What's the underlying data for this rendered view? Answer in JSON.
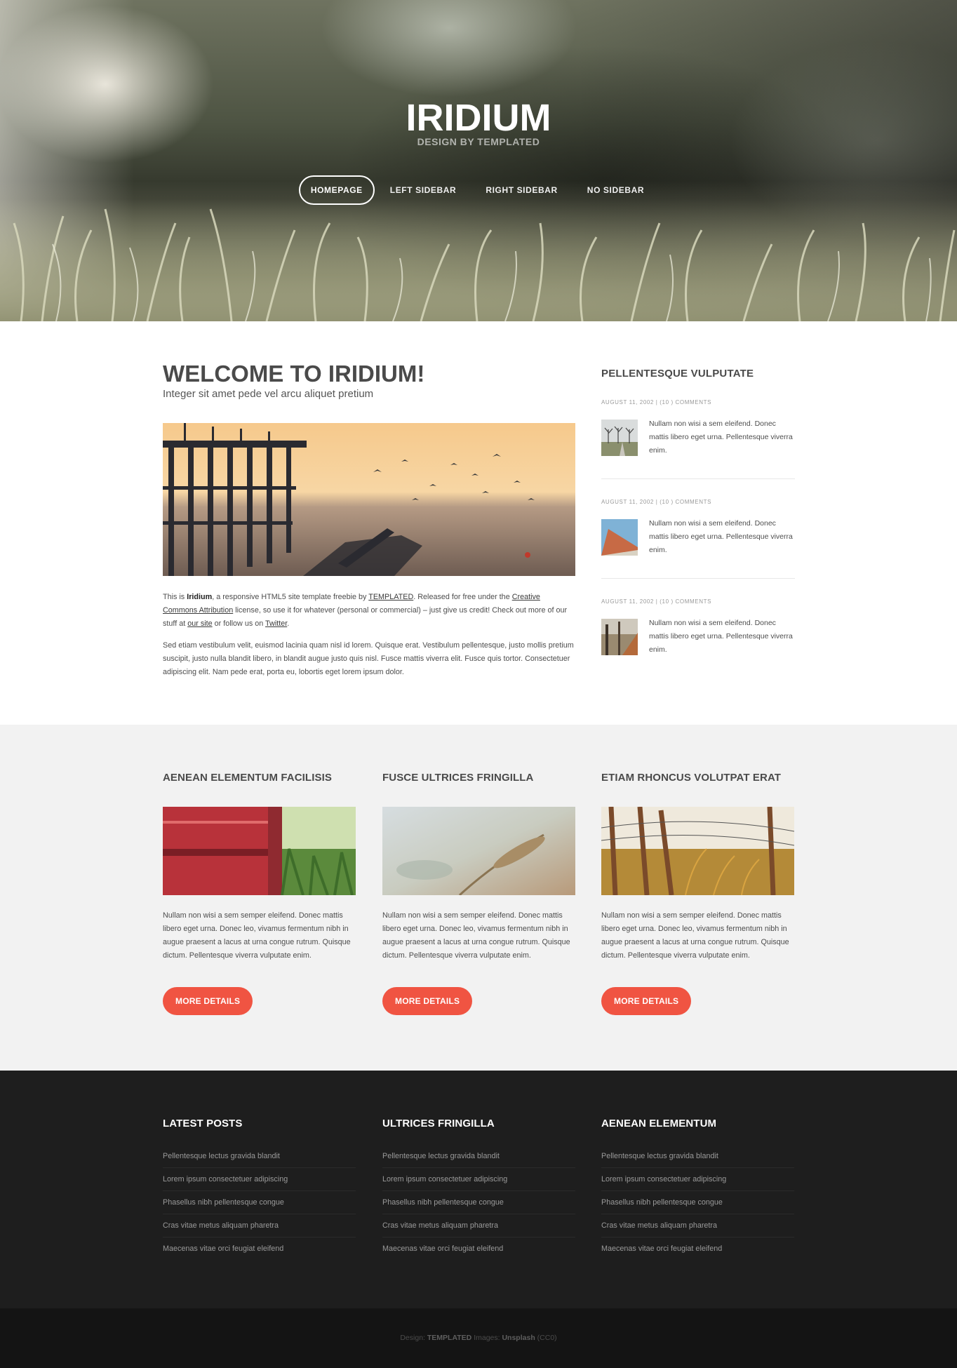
{
  "header": {
    "title": "IRIDIUM",
    "subtitle": "DESIGN BY TEMPLATED",
    "nav": [
      {
        "label": "HOMEPAGE",
        "active": true
      },
      {
        "label": "LEFT SIDEBAR",
        "active": false
      },
      {
        "label": "RIGHT SIDEBAR",
        "active": false
      },
      {
        "label": "NO SIDEBAR",
        "active": false
      }
    ]
  },
  "main": {
    "title": "WELCOME TO IRIDIUM!",
    "lead": "Integer sit amet pede vel arcu aliquet pretium",
    "p1": {
      "t1": "This is ",
      "brand": "Iridium",
      "t2": ", a responsive HTML5 site template freebie by ",
      "link_templated": "TEMPLATED",
      "t3": ". Released for free under the ",
      "link_license": "Creative Commons Attribution",
      "t4": " license, so use it for whatever (personal or commercial) – just give us credit! Check out more of our stuff at ",
      "link_site": "our site",
      "t5": " or follow us on ",
      "link_twitter": "Twitter",
      "t6": "."
    },
    "p2": "Sed etiam vestibulum velit, euismod lacinia quam nisl id lorem. Quisque erat. Vestibulum pellentesque, justo mollis pretium suscipit, justo nulla blandit libero, in blandit augue justo quis nisl. Fusce mattis viverra elit. Fusce quis tortor. Consectetuer adipiscing elit. Nam pede erat, porta eu, lobortis eget lorem ipsum dolor."
  },
  "sidebar": {
    "title": "PELLENTESQUE VULPUTATE",
    "posts": [
      {
        "meta": "AUGUST 11, 2002 | (10 ) COMMENTS",
        "text": "Nullam non wisi a sem eleifend. Donec mattis libero eget urna. Pellentesque viverra enim."
      },
      {
        "meta": "AUGUST 11, 2002 | (10 ) COMMENTS",
        "text": "Nullam non wisi a sem eleifend. Donec mattis libero eget urna. Pellentesque viverra enim."
      },
      {
        "meta": "AUGUST 11, 2002 | (10 ) COMMENTS",
        "text": "Nullam non wisi a sem eleifend. Donec mattis libero eget urna. Pellentesque viverra enim."
      }
    ]
  },
  "features": [
    {
      "title": "AENEAN ELEMENTUM FACILISIS",
      "text": "Nullam non wisi a sem semper eleifend. Donec mattis libero eget urna. Donec leo, vivamus fermentum nibh in augue praesent a lacus at urna congue rutrum. Quisque dictum. Pellentesque viverra vulputate enim.",
      "button": "MORE DETAILS"
    },
    {
      "title": "FUSCE ULTRICES FRINGILLA",
      "text": "Nullam non wisi a sem semper eleifend. Donec mattis libero eget urna. Donec leo, vivamus fermentum nibh in augue praesent a lacus at urna congue rutrum. Quisque dictum. Pellentesque viverra vulputate enim.",
      "button": "MORE DETAILS"
    },
    {
      "title": "ETIAM RHONCUS VOLUTPAT ERAT",
      "text": "Nullam non wisi a sem semper eleifend. Donec mattis libero eget urna. Donec leo, vivamus fermentum nibh in augue praesent a lacus at urna congue rutrum. Quisque dictum. Pellentesque viverra vulputate enim.",
      "button": "MORE DETAILS"
    }
  ],
  "footer": {
    "columns": [
      {
        "title": "LATEST POSTS",
        "links": [
          "Pellentesque lectus gravida blandit",
          "Lorem ipsum consectetuer adipiscing",
          "Phasellus nibh pellentesque congue",
          "Cras vitae metus aliquam pharetra",
          "Maecenas vitae orci feugiat eleifend"
        ]
      },
      {
        "title": "ULTRICES FRINGILLA",
        "links": [
          "Pellentesque lectus gravida blandit",
          "Lorem ipsum consectetuer adipiscing",
          "Phasellus nibh pellentesque congue",
          "Cras vitae metus aliquam pharetra",
          "Maecenas vitae orci feugiat eleifend"
        ]
      },
      {
        "title": "AENEAN ELEMENTUM",
        "links": [
          "Pellentesque lectus gravida blandit",
          "Lorem ipsum consectetuer adipiscing",
          "Phasellus nibh pellentesque congue",
          "Cras vitae metus aliquam pharetra",
          "Maecenas vitae orci feugiat eleifend"
        ]
      }
    ],
    "copyright": {
      "design_label": "Design:",
      "design_value": "TEMPLATED",
      "images_label": "Images:",
      "images_value": "Unsplash",
      "license": "(CC0)"
    }
  },
  "colors": {
    "accent": "#f05442",
    "footer_bg": "#1e1e1e",
    "copyright_bg": "#141414",
    "band_bg": "#f2f2f2"
  }
}
